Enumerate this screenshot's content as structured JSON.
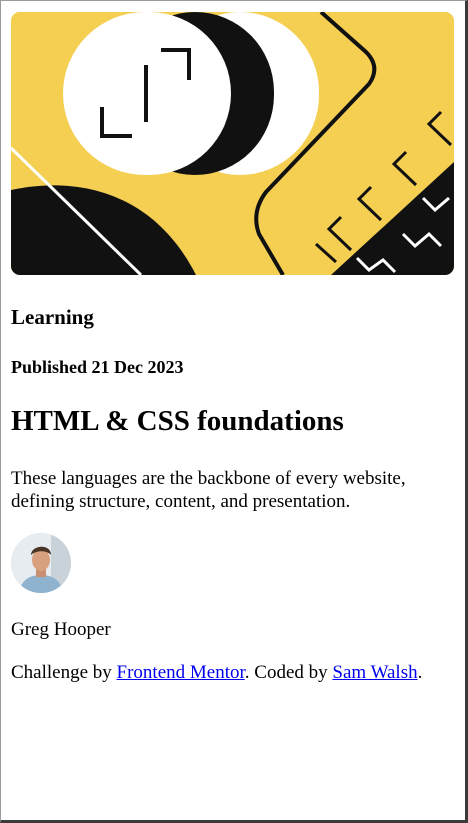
{
  "card": {
    "category": "Learning",
    "published": "Published 21 Dec 2023",
    "title": "HTML & CSS foundations",
    "description": "These languages are the backbone of every website, defining structure, content, and presentation.",
    "author": "Greg Hooper"
  },
  "attribution": {
    "prefix": "Challenge by",
    "link1": "Frontend Mentor",
    "middle": ". Coded by",
    "link2": "Sam Walsh",
    "suffix": "."
  },
  "icons": {
    "hero": "abstract-illustration",
    "avatar": "author-photo"
  },
  "colors": {
    "hero_yellow": "#f4cf52",
    "ink": "#111111",
    "link": "#0000ee"
  }
}
